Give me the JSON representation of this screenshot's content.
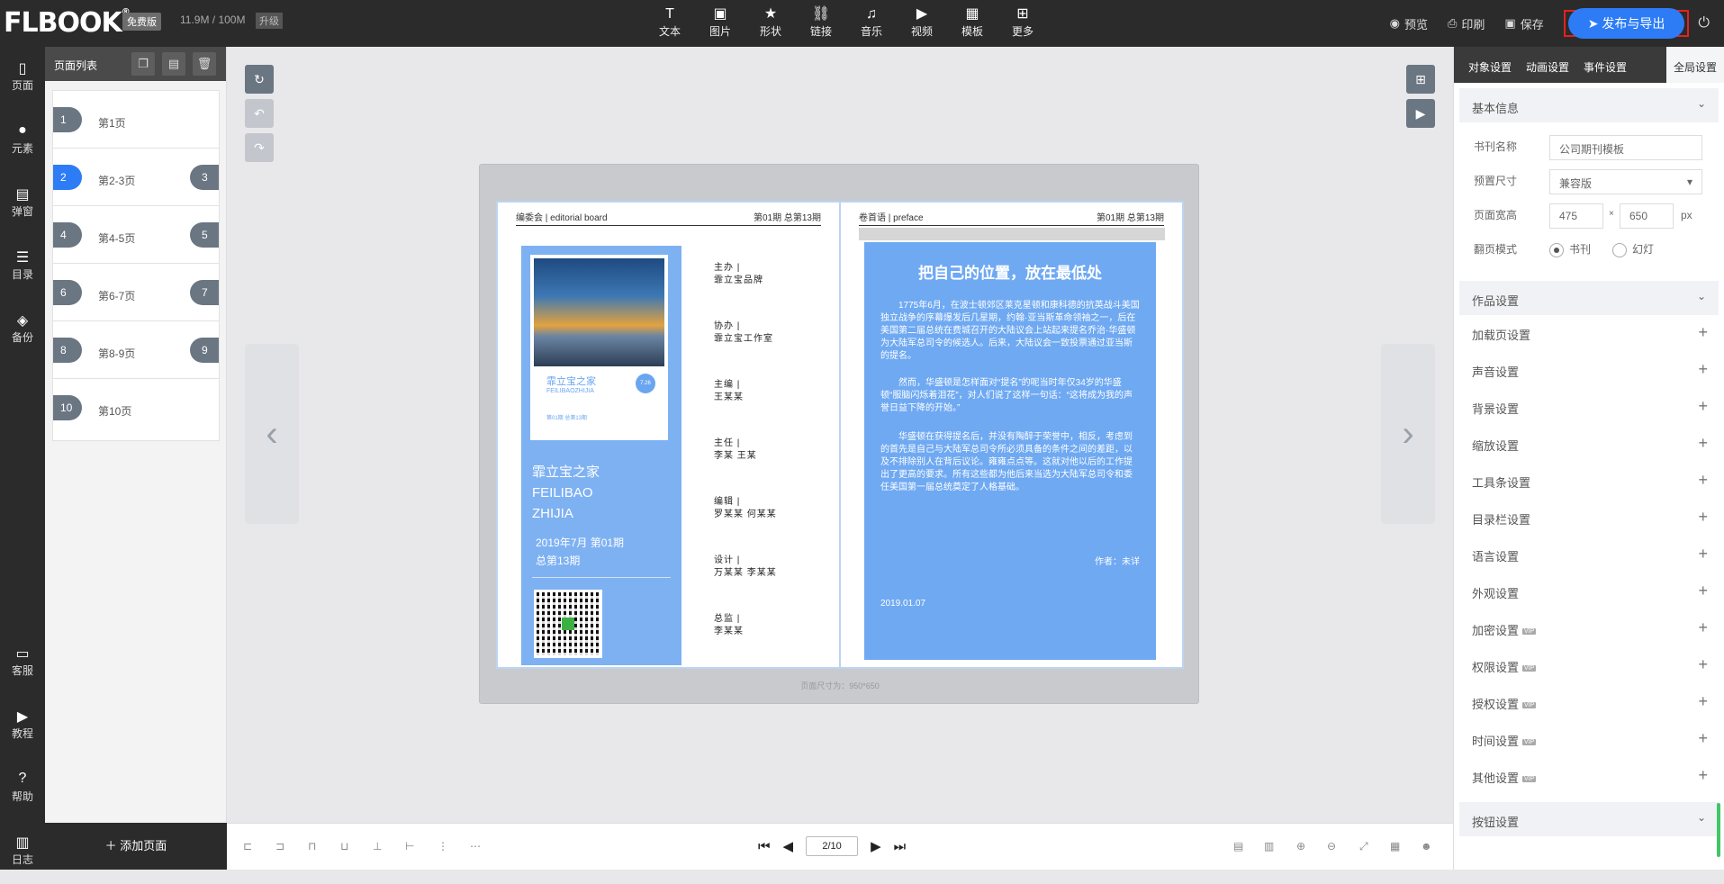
{
  "app": {
    "logo": "FLBOOK",
    "plan": "免费版",
    "usage": "11.9M / 100M",
    "upgrade": "升级"
  },
  "toolbar": [
    {
      "icon": "T",
      "label": "文本"
    },
    {
      "icon": "▣",
      "label": "图片"
    },
    {
      "icon": "★",
      "label": "形状"
    },
    {
      "icon": "⛓",
      "label": "链接"
    },
    {
      "icon": "♫",
      "label": "音乐"
    },
    {
      "icon": "▶",
      "label": "视频"
    },
    {
      "icon": "▦",
      "label": "模板"
    },
    {
      "icon": "⊞",
      "label": "更多"
    }
  ],
  "top_right": {
    "preview": "预览",
    "print": "印刷",
    "save": "保存",
    "publish": "发布与导出"
  },
  "left_nav": {
    "top": [
      {
        "icon": "▯",
        "label": "页面"
      },
      {
        "icon": "●",
        "label": "元素"
      },
      {
        "icon": "▤",
        "label": "弹窗"
      },
      {
        "icon": "☰",
        "label": "目录"
      },
      {
        "icon": "◈",
        "label": "备份"
      }
    ],
    "bottom": [
      {
        "icon": "▭",
        "label": "客服"
      },
      {
        "icon": "▶",
        "label": "教程"
      },
      {
        "icon": "?",
        "label": "帮助"
      },
      {
        "icon": "▥",
        "label": "日志"
      }
    ]
  },
  "page_list": {
    "title": "页面列表",
    "add_label": "添加页面",
    "items": [
      {
        "l": "1",
        "label": "第1页",
        "r": ""
      },
      {
        "l": "2",
        "label": "第2-3页",
        "r": "3",
        "active": true
      },
      {
        "l": "4",
        "label": "第4-5页",
        "r": "5"
      },
      {
        "l": "6",
        "label": "第6-7页",
        "r": "7"
      },
      {
        "l": "8",
        "label": "第8-9页",
        "r": "9"
      },
      {
        "l": "10",
        "label": "第10页",
        "r": ""
      }
    ]
  },
  "left_page": {
    "header_left": "编委会 | editorial board",
    "header_right": "第01期 总第13期",
    "mini_title": "霏立宝之家",
    "mini_sub": "FEILIBAOZHIJIA",
    "mini_circle": "7.26 2019",
    "mini_line": "第01期 总第13期",
    "cover_title": [
      "霏立宝之家",
      "FEILIBAO",
      "ZHIJIA"
    ],
    "cover_date": [
      "2019年7月 第01期",
      "总第13期"
    ],
    "roles": [
      [
        "主办 |",
        "霏立宝品牌"
      ],
      [
        "协办 |",
        "霏立宝工作室"
      ],
      [
        "主编 |",
        "王某某"
      ],
      [
        "主任 |",
        "李某  王某"
      ],
      [
        "编辑 |",
        "罗某某  何某某"
      ],
      [
        "设计 |",
        "万某某  李某某"
      ],
      [
        "总监 |",
        "李某某"
      ]
    ]
  },
  "right_page": {
    "header_left": "卷首语 | preface",
    "header_right": "第01期 总第13期",
    "title": "把自己的位置，放在最低处",
    "paragraphs": [
      "1775年6月，在波士顿郊区莱克星顿和康科德的抗英战斗美国独立战争的序幕爆发后几星期，约翰·亚当斯革命领袖之一，后在美国第二届总统在费城召开的大陆议会上站起来提名乔治·华盛顿为大陆军总司令的候选人。后来，大陆议会一致投票通过亚当斯的提名。",
      "然而，华盛顿是怎样面对“提名”的呢当时年仅34岁的华盛顿“服脑闪烁着泪花”，对人们说了这样一句话：“这将成为我的声誉日益下降的开始。”",
      "华盛顿在获得提名后，并没有陶醉于荣誉中，相反，考虑到的首先是自己与大陆军总司令所必须具备的条件之间的差距，以及不排除别人在背后议论。雍雍点点等。这就对他以后的工作提出了更高的要求。所有这些都为他后来当选为大陆军总司令和委任美国第一届总统奠定了人格基础。"
    ],
    "author": "作者：未详",
    "date": "2019.01.07"
  },
  "stage": {
    "dim_label": "页面尺寸为：950*650"
  },
  "pager": {
    "value": "2/10"
  },
  "right_panel": {
    "tabs": [
      "对象设置",
      "动画设置",
      "事件设置",
      "全局设置"
    ],
    "basic_title": "基本信息",
    "book_name_label": "书刊名称",
    "book_name": "公司期刊模板",
    "preset_label": "预置尺寸",
    "preset": "兼容版",
    "size_label": "页面宽高",
    "width": "475",
    "height": "650",
    "unit": "px",
    "times": "×",
    "flip_label": "翻页模式",
    "mode_book": "书刊",
    "mode_slide": "幻灯",
    "work_title": "作品设置",
    "settings": [
      {
        "label": "加载页设置"
      },
      {
        "label": "声音设置"
      },
      {
        "label": "背景设置"
      },
      {
        "label": "缩放设置"
      },
      {
        "label": "工具条设置"
      },
      {
        "label": "目录栏设置"
      },
      {
        "label": "语言设置"
      },
      {
        "label": "外观设置"
      },
      {
        "label": "加密设置",
        "vip": "VIP"
      },
      {
        "label": "权限设置",
        "vip": "VIP"
      },
      {
        "label": "授权设置",
        "vip": "VIP"
      },
      {
        "label": "时间设置",
        "vip": "VIP"
      },
      {
        "label": "其他设置",
        "vip": "VIP"
      }
    ],
    "button_title": "按钮设置"
  }
}
